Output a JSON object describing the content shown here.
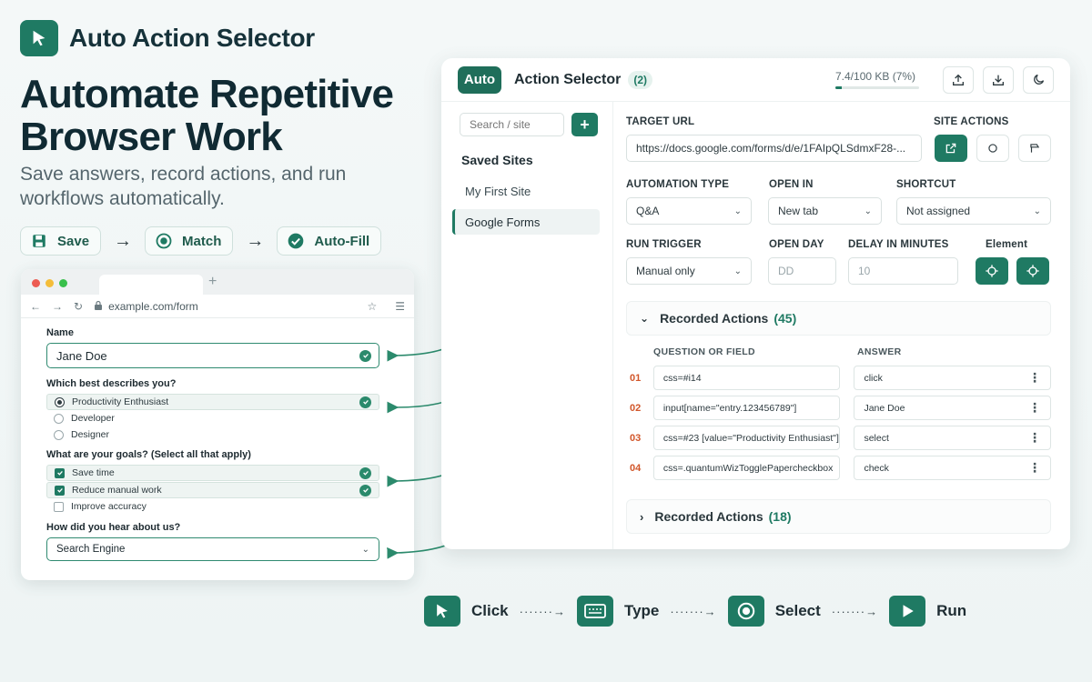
{
  "brand": {
    "name": "Auto Action Selector",
    "icon": "cursor-arrow-icon"
  },
  "hero": {
    "title": "Automate Repetitive Browser Work",
    "subtitle": "Save answers, record actions, and run workflows automatically."
  },
  "flow_steps": [
    {
      "label": "Save",
      "icon": "floppy-disk-icon"
    },
    {
      "label": "Match",
      "icon": "target-icon"
    },
    {
      "label": "Auto-Fill",
      "icon": "check-circle-icon"
    }
  ],
  "browser": {
    "url": "example.com/form",
    "form": {
      "name_label": "Name",
      "name_value": "Jane Doe",
      "describe_label": "Which best describes you?",
      "describe_options": [
        {
          "label": "Productivity Enthusiast",
          "selected": true
        },
        {
          "label": "Developer",
          "selected": false
        },
        {
          "label": "Designer",
          "selected": false
        }
      ],
      "goals_label": "What are your goals? (Select all that apply)",
      "goals_options": [
        {
          "label": "Save time",
          "checked": true
        },
        {
          "label": "Reduce manual work",
          "checked": true
        },
        {
          "label": "Improve accuracy",
          "checked": false
        }
      ],
      "hear_label": "How did you hear about us?",
      "hear_value": "Search Engine"
    }
  },
  "panel": {
    "logo_text": "Auto",
    "title": "Action Selector",
    "count": "(2)",
    "storage_text": "7.4/100 KB (7%)",
    "storage_fraction": 0.074,
    "sidebar": {
      "search_placeholder": "Search / site",
      "add_label": "+",
      "saved_heading": "Saved Sites",
      "sites": [
        {
          "label": "My First Site",
          "active": false
        },
        {
          "label": "Google Forms",
          "active": true
        }
      ]
    },
    "target_url_label": "TARGET URL",
    "target_url_value": "https://docs.google.com/forms/d/e/1FAIpQLSdmxF28-...",
    "site_actions_label": "SITE ACTIONS",
    "automation_type_label": "AUTOMATION TYPE",
    "automation_type_value": "Q&A",
    "open_in_label": "OPEN IN",
    "open_in_value": "New tab",
    "shortcut_label": "SHORTCUT",
    "shortcut_value": "Not assigned",
    "run_trigger_label": "RUN TRIGGER",
    "run_trigger_value": "Manual only",
    "open_day_label": "OPEN DAY",
    "open_day_placeholder": "DD",
    "delay_label": "DELAY IN MINUTES",
    "delay_placeholder": "10",
    "element_label": "Element",
    "recorded_1": {
      "title": "Recorded Actions",
      "count": "(45)",
      "expanded": true
    },
    "columns": {
      "field": "QUESTION OR FIELD",
      "answer": "ANSWER"
    },
    "rows": [
      {
        "num": "01",
        "field": "css=#i14",
        "answer": "click"
      },
      {
        "num": "02",
        "field": "input[name=\"entry.123456789\"]",
        "answer": "Jane Doe"
      },
      {
        "num": "03",
        "field": "css=#23 [value=\"Productivity Enthusiast\"]",
        "answer": "select"
      },
      {
        "num": "04",
        "field": "css=.quantumWizTogglePapercheckbox",
        "answer": "check"
      }
    ],
    "recorded_2": {
      "title": "Recorded Actions",
      "count": "(18)",
      "expanded": false
    }
  },
  "bottom_flow": [
    {
      "label": "Click",
      "icon": "cursor-arrow-icon"
    },
    {
      "label": "Type",
      "icon": "keyboard-icon"
    },
    {
      "label": "Select",
      "icon": "radio-select-icon"
    },
    {
      "label": "Run",
      "icon": "play-icon"
    }
  ],
  "colors": {
    "accent": "#1f7a63",
    "row_number": "#d2572b",
    "title": "#102a33"
  }
}
